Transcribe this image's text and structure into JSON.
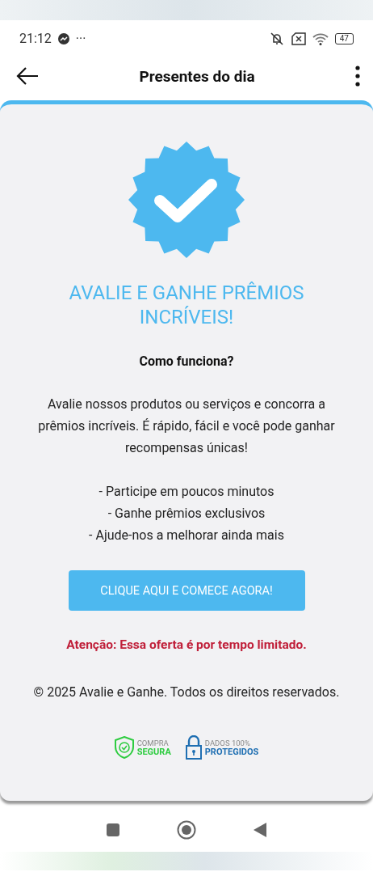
{
  "status_bar": {
    "time": "21:12",
    "dots": "···",
    "battery": "47"
  },
  "app_bar": {
    "title": "Presentes do dia"
  },
  "card": {
    "heading": "AVALIE E GANHE PRÊMIOS INCRÍVEIS!",
    "subheading": "Como funciona?",
    "description": "Avalie nossos produtos ou serviços e concorra a prêmios incríveis. É rápido, fácil e você pode ganhar recompensas únicas!",
    "bullets": [
      "- Participe em poucos minutos",
      "- Ganhe prêmios exclusivos",
      "- Ajude-nos a melhorar ainda mais"
    ],
    "cta": "CLIQUE AQUI E COMECE AGORA!",
    "warning": "Atenção: Essa oferta é por tempo limitado.",
    "footer": "© 2025 Avalie e Ganhe. Todos os direitos reservados.",
    "seals": [
      {
        "kind": "shield",
        "top": "COMPRA",
        "bottom": "SEGURA",
        "color": "#2ecc40"
      },
      {
        "kind": "lock",
        "top": "DADOS 100%",
        "bottom": "PROTEGIDOS",
        "color": "#1f6fb2"
      }
    ]
  }
}
